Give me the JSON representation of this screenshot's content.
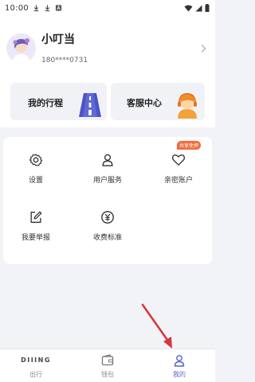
{
  "status_bar": {
    "time": "10:00"
  },
  "profile": {
    "name": "小叮当",
    "phone": "180****0731"
  },
  "quick_actions": [
    {
      "label": "我的行程",
      "icon": "road-icon"
    },
    {
      "label": "客服中心",
      "icon": "customer-service-icon"
    }
  ],
  "menu": [
    {
      "label": "设置",
      "icon": "gear-icon"
    },
    {
      "label": "用户服务",
      "icon": "user-icon"
    },
    {
      "label": "亲密账户",
      "icon": "heart-icon",
      "badge": "共享免押"
    },
    {
      "label": "我要举报",
      "icon": "edit-icon"
    },
    {
      "label": "收费标准",
      "icon": "yuan-icon"
    }
  ],
  "tabbar": {
    "items": [
      {
        "label": "出行",
        "logo_text": "DIIING"
      },
      {
        "label": "钱包"
      },
      {
        "label": "我的",
        "active": true
      }
    ]
  },
  "colors": {
    "accent": "#5a63c9",
    "badge": "#f26a3a",
    "annotation_arrow": "#d9363e"
  }
}
